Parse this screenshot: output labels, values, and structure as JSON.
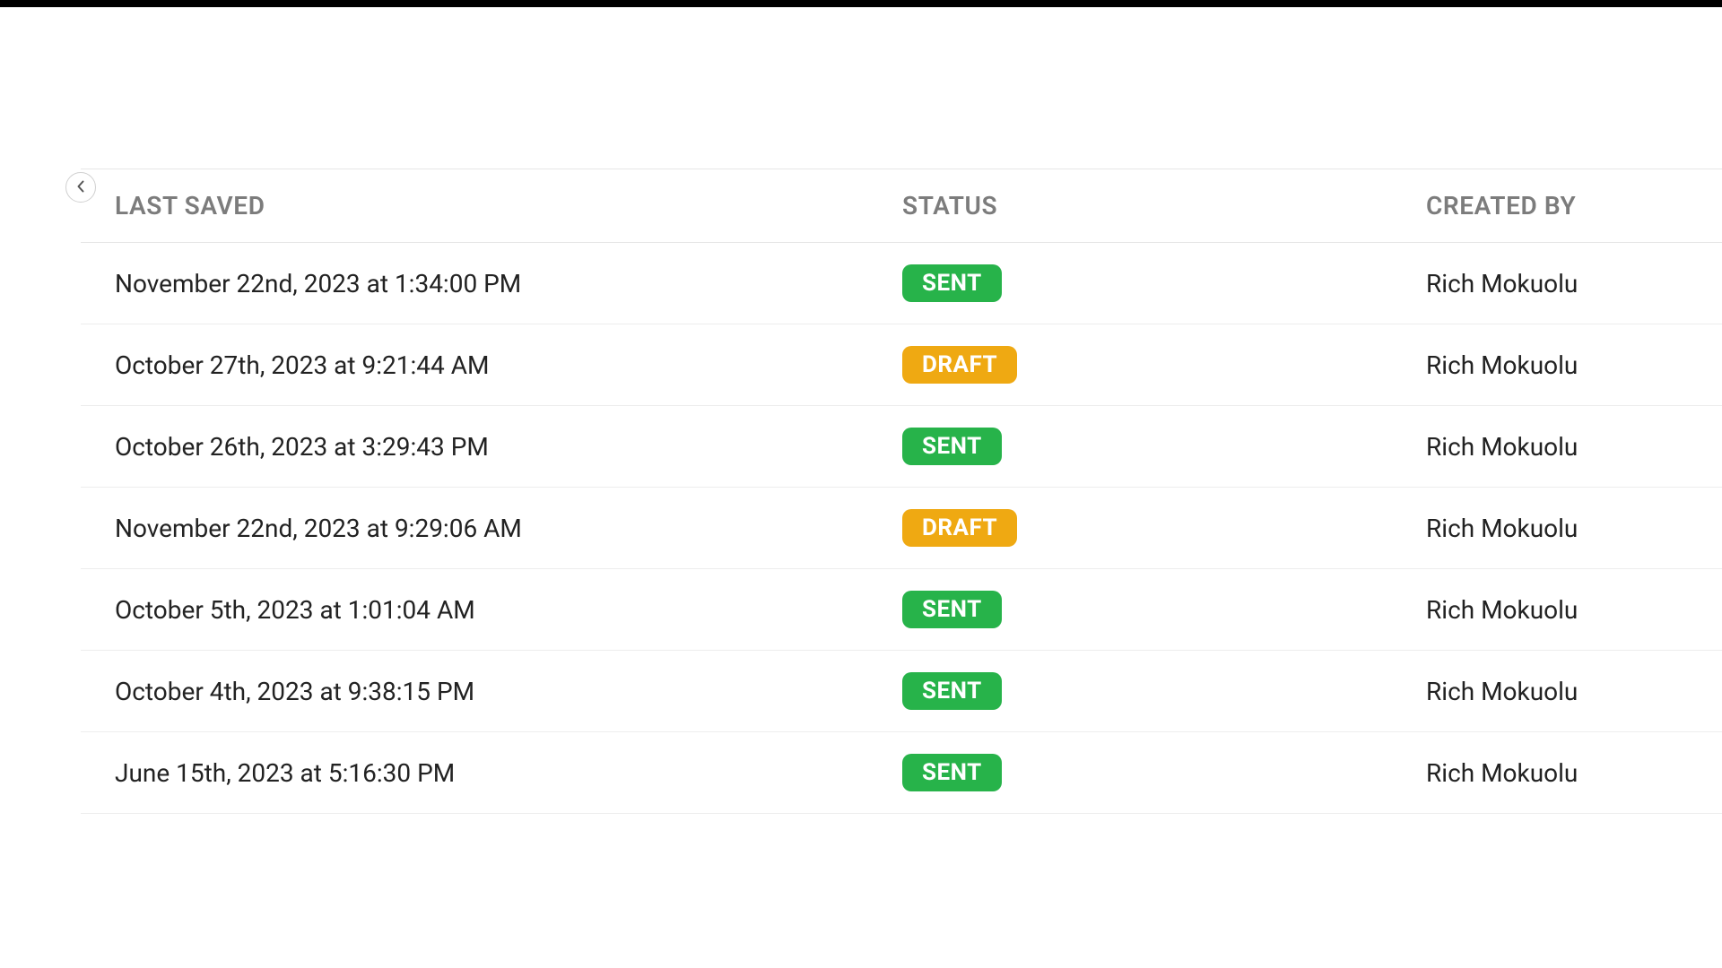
{
  "columns": {
    "last_saved": "LAST SAVED",
    "status": "STATUS",
    "created_by": "CREATED BY"
  },
  "status_labels": {
    "sent": "SENT",
    "draft": "DRAFT"
  },
  "rows": [
    {
      "last_saved": "November 22nd, 2023 at 1:34:00 PM",
      "status": "sent",
      "created_by": "Rich Mokuolu"
    },
    {
      "last_saved": "October 27th, 2023 at 9:21:44 AM",
      "status": "draft",
      "created_by": "Rich Mokuolu"
    },
    {
      "last_saved": "October 26th, 2023 at 3:29:43 PM",
      "status": "sent",
      "created_by": "Rich Mokuolu"
    },
    {
      "last_saved": "November 22nd, 2023 at 9:29:06 AM",
      "status": "draft",
      "created_by": "Rich Mokuolu"
    },
    {
      "last_saved": "October 5th, 2023 at 1:01:04 AM",
      "status": "sent",
      "created_by": "Rich Mokuolu"
    },
    {
      "last_saved": "October 4th, 2023 at 9:38:15 PM",
      "status": "sent",
      "created_by": "Rich Mokuolu"
    },
    {
      "last_saved": "June 15th, 2023 at 5:16:30 PM",
      "status": "sent",
      "created_by": "Rich Mokuolu"
    }
  ]
}
